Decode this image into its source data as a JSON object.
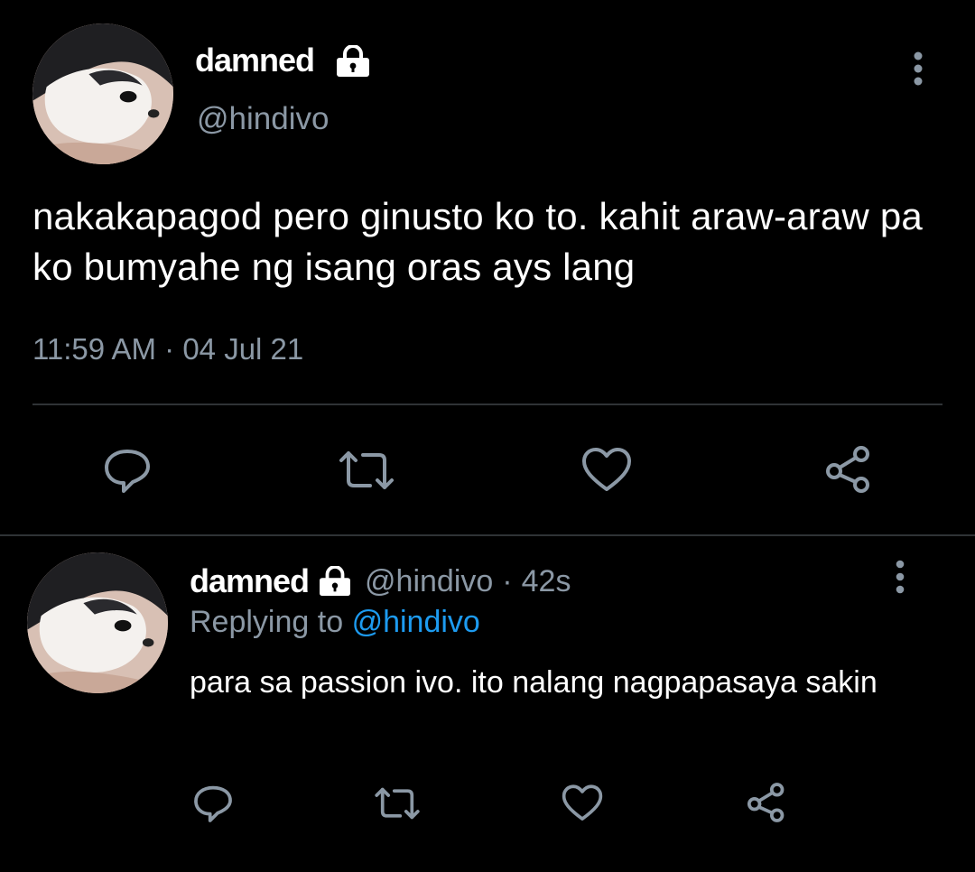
{
  "main_tweet": {
    "author_name": "damned",
    "author_handle": "@hindivo",
    "text": "nakakapagod pero ginusto ko to. kahit araw-araw pa ko bumyahe ng isang oras ays lang",
    "time": "11:59 AM",
    "date_separator": "·",
    "date": "04 Jul 21"
  },
  "reply": {
    "author_name": "damned",
    "author_handle": "@hindivo",
    "separator": "·",
    "age": "42s",
    "replying_to_label": "Replying to",
    "replying_to_handle": "@hindivo",
    "text": "para sa passion ivo. ito nalang nagpapasaya sakin"
  },
  "icons": {
    "lock": "lock-icon",
    "more": "more-vertical-icon",
    "reply": "reply-icon",
    "retweet": "retweet-icon",
    "like": "heart-icon",
    "share": "share-icon"
  },
  "colors": {
    "background": "#000000",
    "primary_text": "#ffffff",
    "secondary_text": "#8b98a5",
    "link": "#1d9bf0",
    "divider": "#2f3336"
  }
}
